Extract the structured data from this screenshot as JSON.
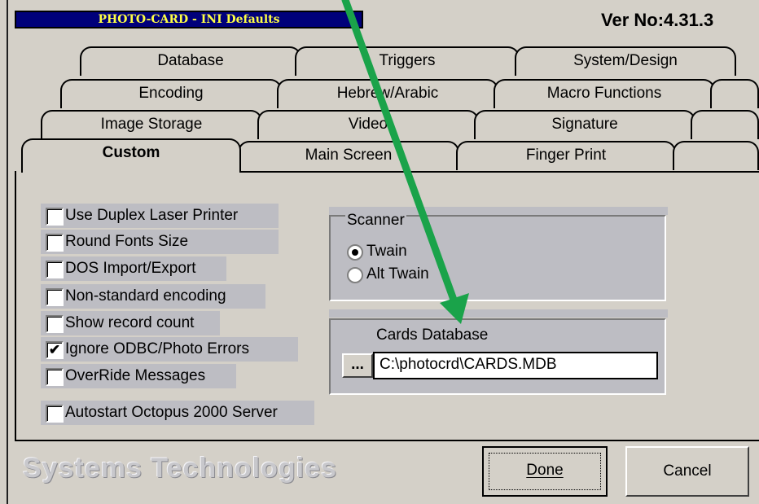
{
  "window": {
    "title": "PHOTO-CARD - INI Defaults",
    "version": "Ver No:4.31.3"
  },
  "tabs": {
    "row1": [
      "Database",
      "Triggers",
      "System/Design"
    ],
    "row2": [
      "Encoding",
      "Hebrew/Arabic",
      "Macro Functions"
    ],
    "row3": [
      "Image Storage",
      "Video",
      "Signature"
    ],
    "row4": [
      "Custom",
      "Main Screen",
      "Finger Print"
    ],
    "active": "Custom"
  },
  "options": [
    {
      "label": "Use Duplex Laser Printer",
      "checked": false
    },
    {
      "label": "Round Fonts Size",
      "checked": false
    },
    {
      "label": "DOS Import/Export",
      "checked": false
    },
    {
      "label": "Non-standard encoding",
      "checked": false
    },
    {
      "label": "Show record count",
      "checked": false
    },
    {
      "label": "Ignore ODBC/Photo Errors",
      "checked": true
    },
    {
      "label": "OverRide Messages",
      "checked": false
    }
  ],
  "autostart": {
    "label": "Autostart Octopus 2000 Server",
    "checked": false
  },
  "scanner": {
    "label": "Scanner",
    "options": [
      {
        "label": "Twain",
        "selected": true
      },
      {
        "label": "Alt Twain",
        "selected": false
      }
    ]
  },
  "cards_db": {
    "label": "Cards Database",
    "browse_label": "...",
    "path": "C:\\photocrd\\CARDS.MDB"
  },
  "buttons": {
    "done": "Done",
    "cancel": "Cancel"
  },
  "branding": "Systems Technologies",
  "colors": {
    "annotation_arrow": "#1aa34a",
    "title_bar": "#00007a",
    "title_text": "#ffff44"
  },
  "icons": {
    "check": "✔",
    "arrow": "annotation-arrow"
  }
}
